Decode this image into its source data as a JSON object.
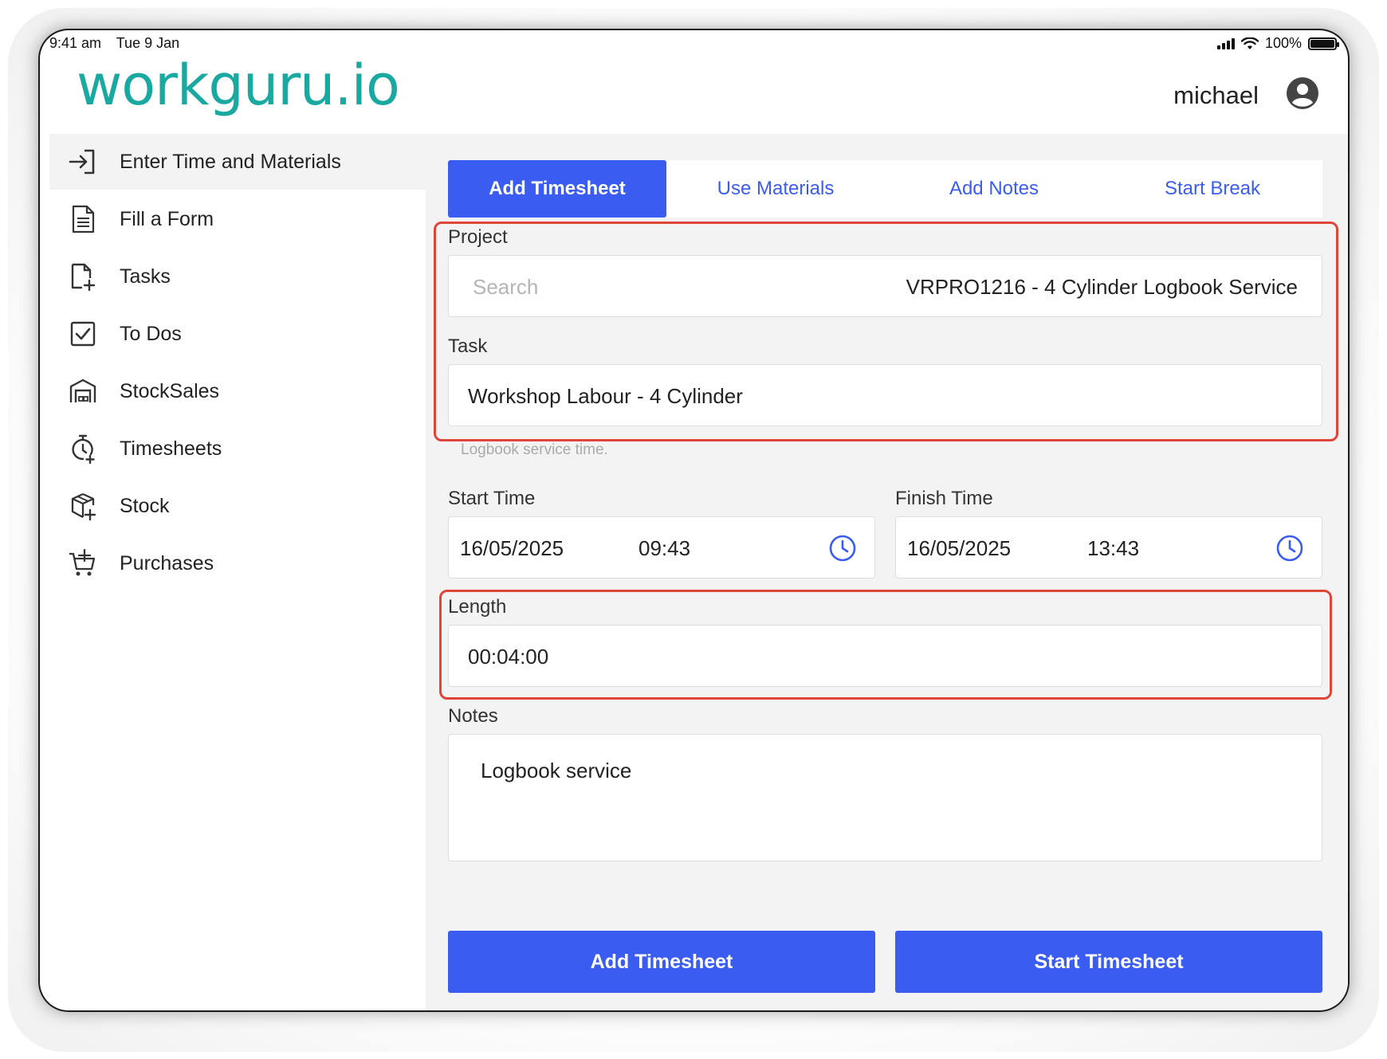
{
  "status_bar": {
    "time": "9:41 am",
    "date": "Tue 9 Jan",
    "battery": "100%"
  },
  "header": {
    "logo": "workguru.io",
    "user_name": "michael"
  },
  "sidebar": {
    "items": [
      {
        "label": "Enter Time and Materials",
        "icon": "enter-icon"
      },
      {
        "label": "Fill a Form",
        "icon": "form-icon"
      },
      {
        "label": "Tasks",
        "icon": "task-add-icon"
      },
      {
        "label": "To Dos",
        "icon": "checkbox-icon"
      },
      {
        "label": "StockSales",
        "icon": "warehouse-icon"
      },
      {
        "label": "Timesheets",
        "icon": "stopwatch-icon"
      },
      {
        "label": "Stock",
        "icon": "box-icon"
      },
      {
        "label": "Purchases",
        "icon": "cart-icon"
      }
    ]
  },
  "tabs": [
    {
      "label": "Add Timesheet",
      "active": true
    },
    {
      "label": "Use Materials",
      "active": false
    },
    {
      "label": "Add Notes",
      "active": false
    },
    {
      "label": "Start Break",
      "active": false
    }
  ],
  "form": {
    "project_label": "Project",
    "project_placeholder": "Search",
    "project_value": "VRPRO1216 - 4 Cylinder Logbook Service",
    "task_label": "Task",
    "task_value": "Workshop Labour - 4 Cylinder",
    "task_hint": "Logbook service time.",
    "start_label": "Start Time",
    "start_date": "16/05/2025",
    "start_time": "09:43",
    "finish_label": "Finish Time",
    "finish_date": "16/05/2025",
    "finish_time": "13:43",
    "length_label": "Length",
    "length_value": "00:04:00",
    "notes_label": "Notes",
    "notes_value": "Logbook service"
  },
  "buttons": {
    "add": "Add Timesheet",
    "start": "Start Timesheet"
  },
  "colors": {
    "accent": "#3b5cf0",
    "highlight": "#e0453a",
    "logo": "#1aa9a0"
  }
}
